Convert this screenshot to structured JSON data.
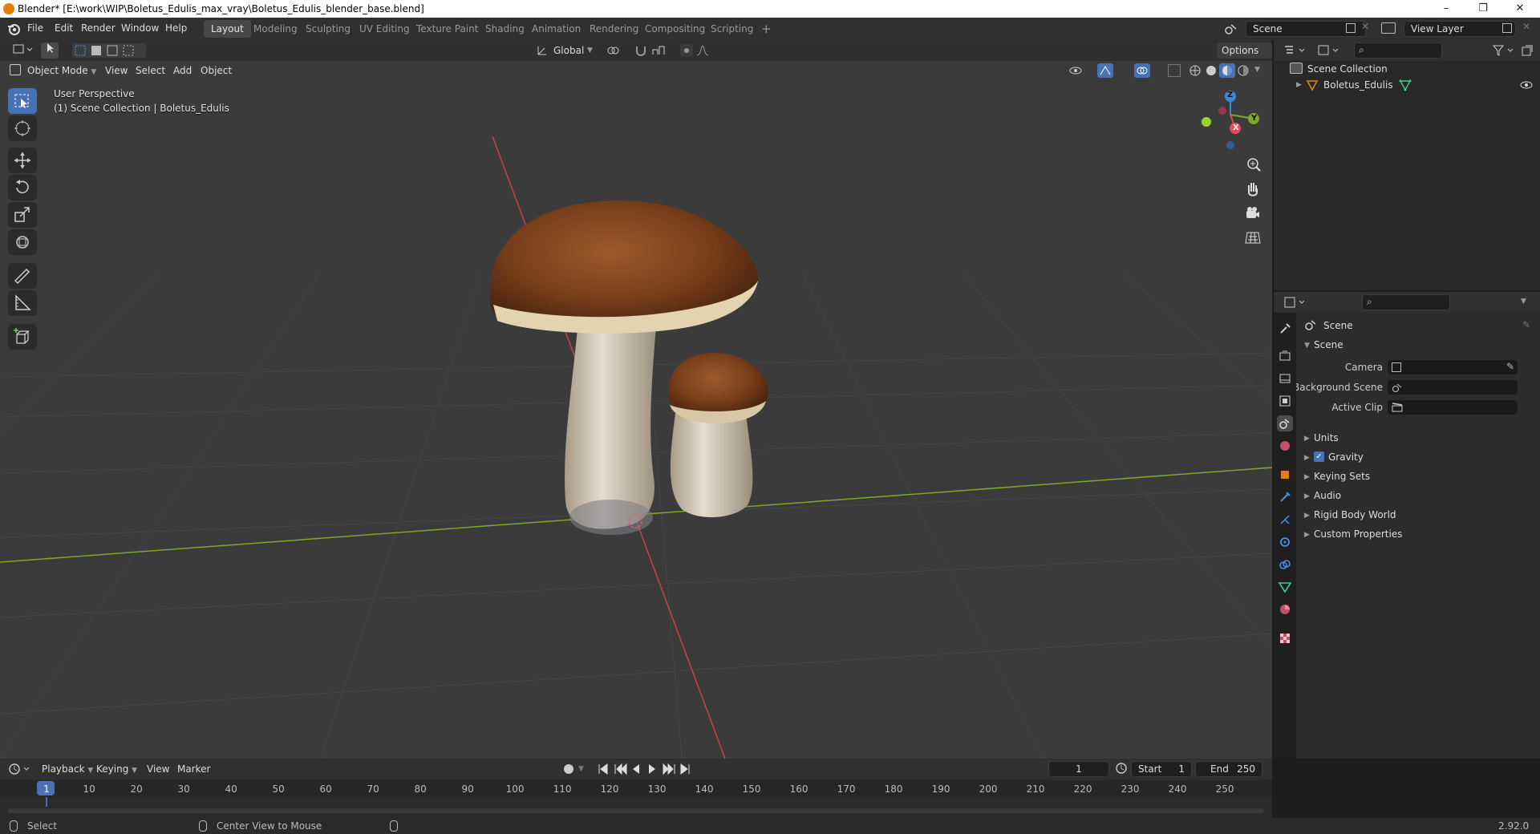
{
  "window": {
    "title": "Blender* [E:\\work\\WIP\\Boletus_Edulis_max_vray\\Boletus_Edulis_blender_base.blend]",
    "minimize": "–",
    "maximize": "❐",
    "close": "✕"
  },
  "menubar": {
    "items": [
      "File",
      "Edit",
      "Render",
      "Window",
      "Help"
    ]
  },
  "workspaces": [
    "Layout",
    "Modeling",
    "Sculpting",
    "UV Editing",
    "Texture Paint",
    "Shading",
    "Animation",
    "Rendering",
    "Compositing",
    "Scripting"
  ],
  "workspace_add": "+",
  "scene_field": "Scene",
  "view_layer_field": "View Layer",
  "viewport": {
    "transform_orientation": "Global",
    "options_label": "Options",
    "mode": "Object Mode",
    "menus": [
      "View",
      "Select",
      "Add",
      "Object"
    ],
    "overlay_line1": "User Perspective",
    "overlay_line2": "(1) Scene Collection | Boletus_Edulis",
    "gizmo": {
      "x": "X",
      "y": "Y",
      "z": "Z"
    }
  },
  "outliner": {
    "scene_collection": "Scene Collection",
    "object": "Boletus_Edulis"
  },
  "properties": {
    "header": "Scene",
    "panel": "Scene",
    "fields": [
      {
        "label": "Camera"
      },
      {
        "label": "Background Scene"
      },
      {
        "label": "Active Clip"
      }
    ],
    "subpanels": [
      "Units",
      "Gravity",
      "Keying Sets",
      "Audio",
      "Rigid Body World",
      "Custom Properties"
    ],
    "gravity_checked": true
  },
  "timeline": {
    "menus": [
      "Playback",
      "Keying",
      "View",
      "Marker"
    ],
    "current_frame": "1",
    "start_label": "Start",
    "start_value": "1",
    "end_label": "End",
    "end_value": "250",
    "ticks": [
      "1",
      "10",
      "20",
      "30",
      "40",
      "50",
      "60",
      "70",
      "80",
      "90",
      "100",
      "110",
      "120",
      "130",
      "140",
      "150",
      "160",
      "170",
      "180",
      "190",
      "200",
      "210",
      "220",
      "230",
      "240",
      "250"
    ]
  },
  "statusbar": {
    "left": "Select",
    "middle": "Center View to Mouse",
    "version": "2.92.0"
  },
  "colors": {
    "accent": "#4772b3",
    "x_axis": "#e04a5a",
    "y_axis": "#7ea829",
    "z_axis": "#3c87d6",
    "object_orange": "#e87d0d"
  }
}
